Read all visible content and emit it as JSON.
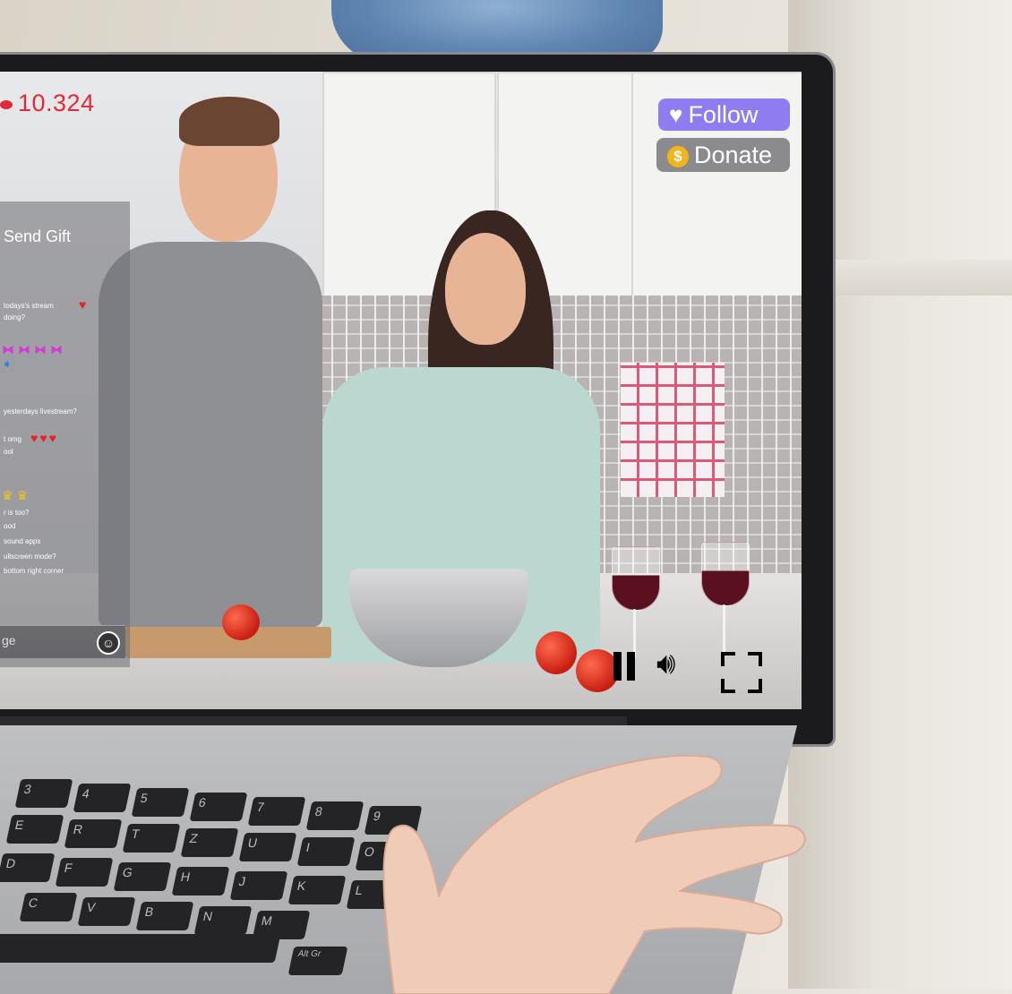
{
  "stream": {
    "viewer_count": "10.324",
    "send_gift_label": "Send Gift",
    "follow_label": "Follow",
    "donate_label": "Donate",
    "message_placeholder": "ge",
    "icons": {
      "viewer": "eye-icon",
      "follow": "heart-icon",
      "donate": "coin-icon",
      "emoji": "smiley-icon",
      "pause": "pause-icon",
      "volume": "volume-icon",
      "fullscreen": "fullscreen-icon"
    },
    "colors": {
      "viewer_count": "#e02a36",
      "follow_button": "#8f7cf0",
      "donate_button": "#8b8b8d",
      "coin": "#f2b51b"
    }
  },
  "chat": {
    "messages": [
      "todays's stream",
      "doing?",
      "yesterdays livestream?",
      "t omg",
      "ool",
      "r is too?",
      "ood",
      "sound apps",
      "ullscreen mode?",
      "bottom right corner"
    ]
  },
  "keyboard": {
    "keys": [
      "3",
      "4",
      "5",
      "6",
      "7",
      "8",
      "9",
      "E",
      "R",
      "T",
      "Z",
      "U",
      "I",
      "O",
      "D",
      "F",
      "G",
      "H",
      "J",
      "K",
      "L",
      "C",
      "V",
      "B",
      "N",
      "M",
      "Alt Gr"
    ]
  }
}
